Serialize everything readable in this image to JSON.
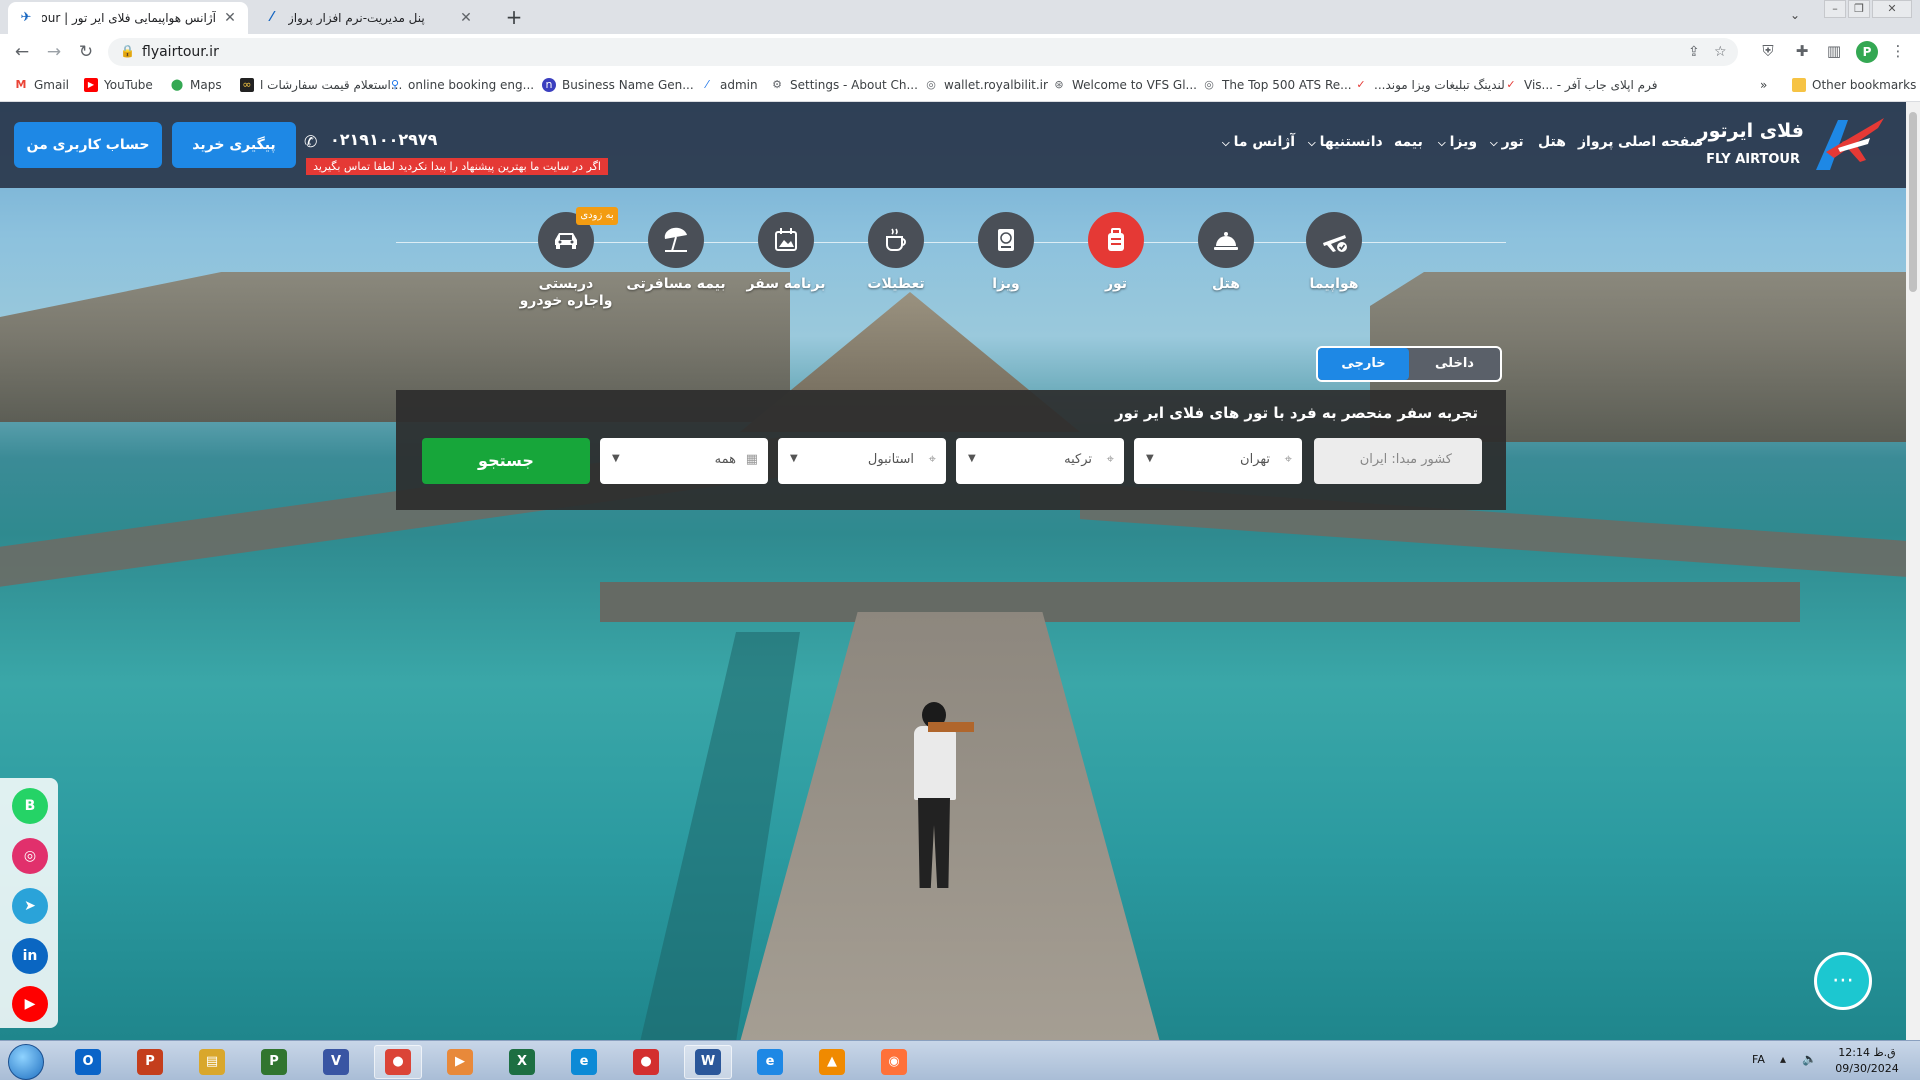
{
  "browser": {
    "tabs": [
      {
        "title": "آژانس هواپیمایی فلای ایر تور | flyairtour",
        "active": true
      },
      {
        "title": "پنل مدیریت-نرم افزار پرواز",
        "active": false
      }
    ],
    "new_tab": "+",
    "url": "flyairtour.ir",
    "profile_initial": "P",
    "bookmarks": [
      {
        "label": "Gmail",
        "icon": "gmail-icon",
        "color": "#ea4335"
      },
      {
        "label": "YouTube",
        "icon": "youtube-icon",
        "color": "#ff0000"
      },
      {
        "label": "Maps",
        "icon": "maps-icon",
        "color": "#34a853"
      },
      {
        "label": "استعلام قیمت سفارشات ا...",
        "icon": "link-icon",
        "color": "#333333"
      },
      {
        "label": "online booking eng...",
        "icon": "search-icon",
        "color": "#1a73e8"
      },
      {
        "label": "Business Name Gen...",
        "icon": "namelix-icon",
        "color": "#3b3fbf"
      },
      {
        "label": "admin",
        "icon": "feather-icon",
        "color": "#1a73e8"
      },
      {
        "label": "Settings - About Ch...",
        "icon": "gear-icon",
        "color": "#5f6368"
      },
      {
        "label": "wallet.royalbilit.ir",
        "icon": "globe-icon",
        "color": "#5f6368"
      },
      {
        "label": "Welcome to VFS Gl...",
        "icon": "vfs-icon",
        "color": "#5f6368"
      },
      {
        "label": "The Top 500 ATS Re...",
        "icon": "globe-icon",
        "color": "#5f6368"
      },
      {
        "label": "لندینگ تبلیغات ویزا موند...",
        "icon": "check-icon",
        "color": "#e53935"
      },
      {
        "label": "فرم اپلای جاب آفر - ...Vis",
        "icon": "check-icon",
        "color": "#e53935"
      }
    ],
    "bookmarks_overflow": "»",
    "other_bookmarks": "Other bookmarks"
  },
  "site": {
    "logo_fa": "فلای ایرتور",
    "logo_en": "FLY AIRTOUR",
    "nav": [
      {
        "label": "صفحه اصلی",
        "caret": false
      },
      {
        "label": "پرواز",
        "caret": false
      },
      {
        "label": "هتل",
        "caret": false
      },
      {
        "label": "تور",
        "caret": true
      },
      {
        "label": "ویزا",
        "caret": true
      },
      {
        "label": "بیمه",
        "caret": false
      },
      {
        "label": "دانستنیها",
        "caret": true
      },
      {
        "label": "آژانس ما",
        "caret": true
      }
    ],
    "phone": "۰۲۱۹۱۰۰۲۹۷۹",
    "promo": "اگر در سایت ما بهترین پیشنهاد را پیدا نکردید لطفا تماس بگیرید",
    "track_button": "پیگیری خرید",
    "account_button": "حساب کاربری من",
    "services": [
      {
        "label": "هواپیما",
        "icon": "airplane-icon",
        "active": false
      },
      {
        "label": "هتل",
        "icon": "cloche-icon",
        "active": false
      },
      {
        "label": "تور",
        "icon": "luggage-icon",
        "active": true
      },
      {
        "label": "ویزا",
        "icon": "passport-icon",
        "active": false
      },
      {
        "label": "تعطیلات",
        "icon": "coffee-icon",
        "active": false
      },
      {
        "label": "برنامه سفر",
        "icon": "calendar-icon",
        "active": false
      },
      {
        "label": "بیمه مسافرتی",
        "icon": "umbrella-icon",
        "active": false
      },
      {
        "label": "دربستی واجاره خودرو",
        "icon": "car-icon",
        "active": false
      }
    ],
    "soon_badge": "به زودی",
    "tour_type": {
      "domestic": "داخلی",
      "international": "خارجی",
      "selected": "international"
    },
    "search": {
      "title": "تجربه سفر منحصر به فرد با تور های فلای ایر تور",
      "origin_country": "کشور مبدا: ایران",
      "origin_city": "تهران",
      "destination_country": "ترکیه",
      "destination_city": "استانبول",
      "date": "همه",
      "button": "جستجو"
    },
    "social": [
      {
        "icon": "whatsapp-business-icon",
        "glyph": "B",
        "color": "#25d366"
      },
      {
        "icon": "instagram-icon",
        "glyph": "◎",
        "color": "#e1306c"
      },
      {
        "icon": "telegram-icon",
        "glyph": "➤",
        "color": "#2aa3d9"
      },
      {
        "icon": "linkedin-icon",
        "glyph": "in",
        "color": "#0a66c2"
      },
      {
        "icon": "youtube-icon",
        "glyph": "▶",
        "color": "#ff0000"
      }
    ]
  },
  "taskbar": {
    "apps": [
      {
        "icon": "outlook-icon",
        "glyph": "O",
        "color": "#0a64c8",
        "running": false
      },
      {
        "icon": "powerpoint-icon",
        "glyph": "P",
        "color": "#c43e1c",
        "running": false
      },
      {
        "icon": "file-explorer-icon",
        "glyph": "▤",
        "color": "#d9a72c",
        "running": false
      },
      {
        "icon": "project-icon",
        "glyph": "P",
        "color": "#31752f",
        "running": false
      },
      {
        "icon": "visio-icon",
        "glyph": "V",
        "color": "#3955a3",
        "running": false
      },
      {
        "icon": "chrome-icon",
        "glyph": "●",
        "color": "#db4437",
        "running": true
      },
      {
        "icon": "media-player-icon",
        "glyph": "▶",
        "color": "#e8893a",
        "running": false
      },
      {
        "icon": "excel-icon",
        "glyph": "X",
        "color": "#1d6f42",
        "running": false
      },
      {
        "icon": "edge-icon",
        "glyph": "e",
        "color": "#0c8ad6",
        "running": false
      },
      {
        "icon": "record-icon",
        "glyph": "●",
        "color": "#d32f2f",
        "running": false
      },
      {
        "icon": "word-icon",
        "glyph": "W",
        "color": "#2b579a",
        "running": true
      },
      {
        "icon": "internet-explorer-icon",
        "glyph": "e",
        "color": "#1e88e5",
        "running": false
      },
      {
        "icon": "vlc-icon",
        "glyph": "▲",
        "color": "#f08a00",
        "running": false
      },
      {
        "icon": "firefox-icon",
        "glyph": "◉",
        "color": "#ff7139",
        "running": false
      }
    ],
    "language": "FA",
    "time": "12:14 ق.ظ",
    "date": "09/30/2024"
  }
}
